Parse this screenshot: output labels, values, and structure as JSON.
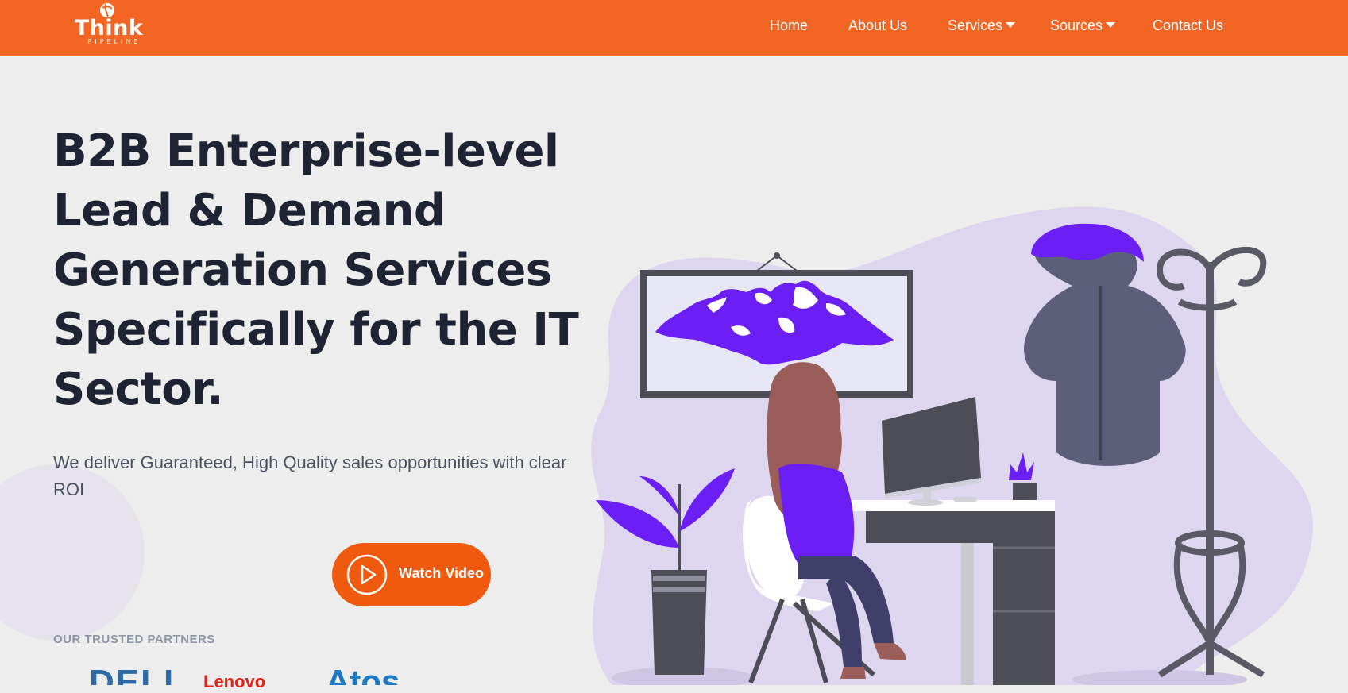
{
  "header": {
    "logo": {
      "word": "Think",
      "sub": "PIPELINE"
    },
    "nav": [
      {
        "label": "Home",
        "dropdown": false
      },
      {
        "label": "About Us",
        "dropdown": false
      },
      {
        "label": "Services",
        "dropdown": true
      },
      {
        "label": "Sources",
        "dropdown": true
      },
      {
        "label": "Contact Us",
        "dropdown": false
      }
    ]
  },
  "hero": {
    "title": "B2B Enterprise-level Lead & Demand Generation Services Specifically for the IT Sector.",
    "subtitle": "We deliver Guaranteed, High Quality sales opportunities with clear ROI",
    "watch_video_label": "Watch Video"
  },
  "partners": {
    "label": "OUR TRUSTED PARTNERS",
    "logos": [
      "DELL",
      "Lenovo",
      "Atos"
    ]
  },
  "colors": {
    "brand_orange": "#f26522",
    "button_orange": "#ef5a0f",
    "illustration_purple": "#6c1ff5",
    "blob_lavender": "#ddd6ee"
  },
  "icons": {
    "play": "play-circle-icon",
    "caret": "caret-down-icon"
  }
}
